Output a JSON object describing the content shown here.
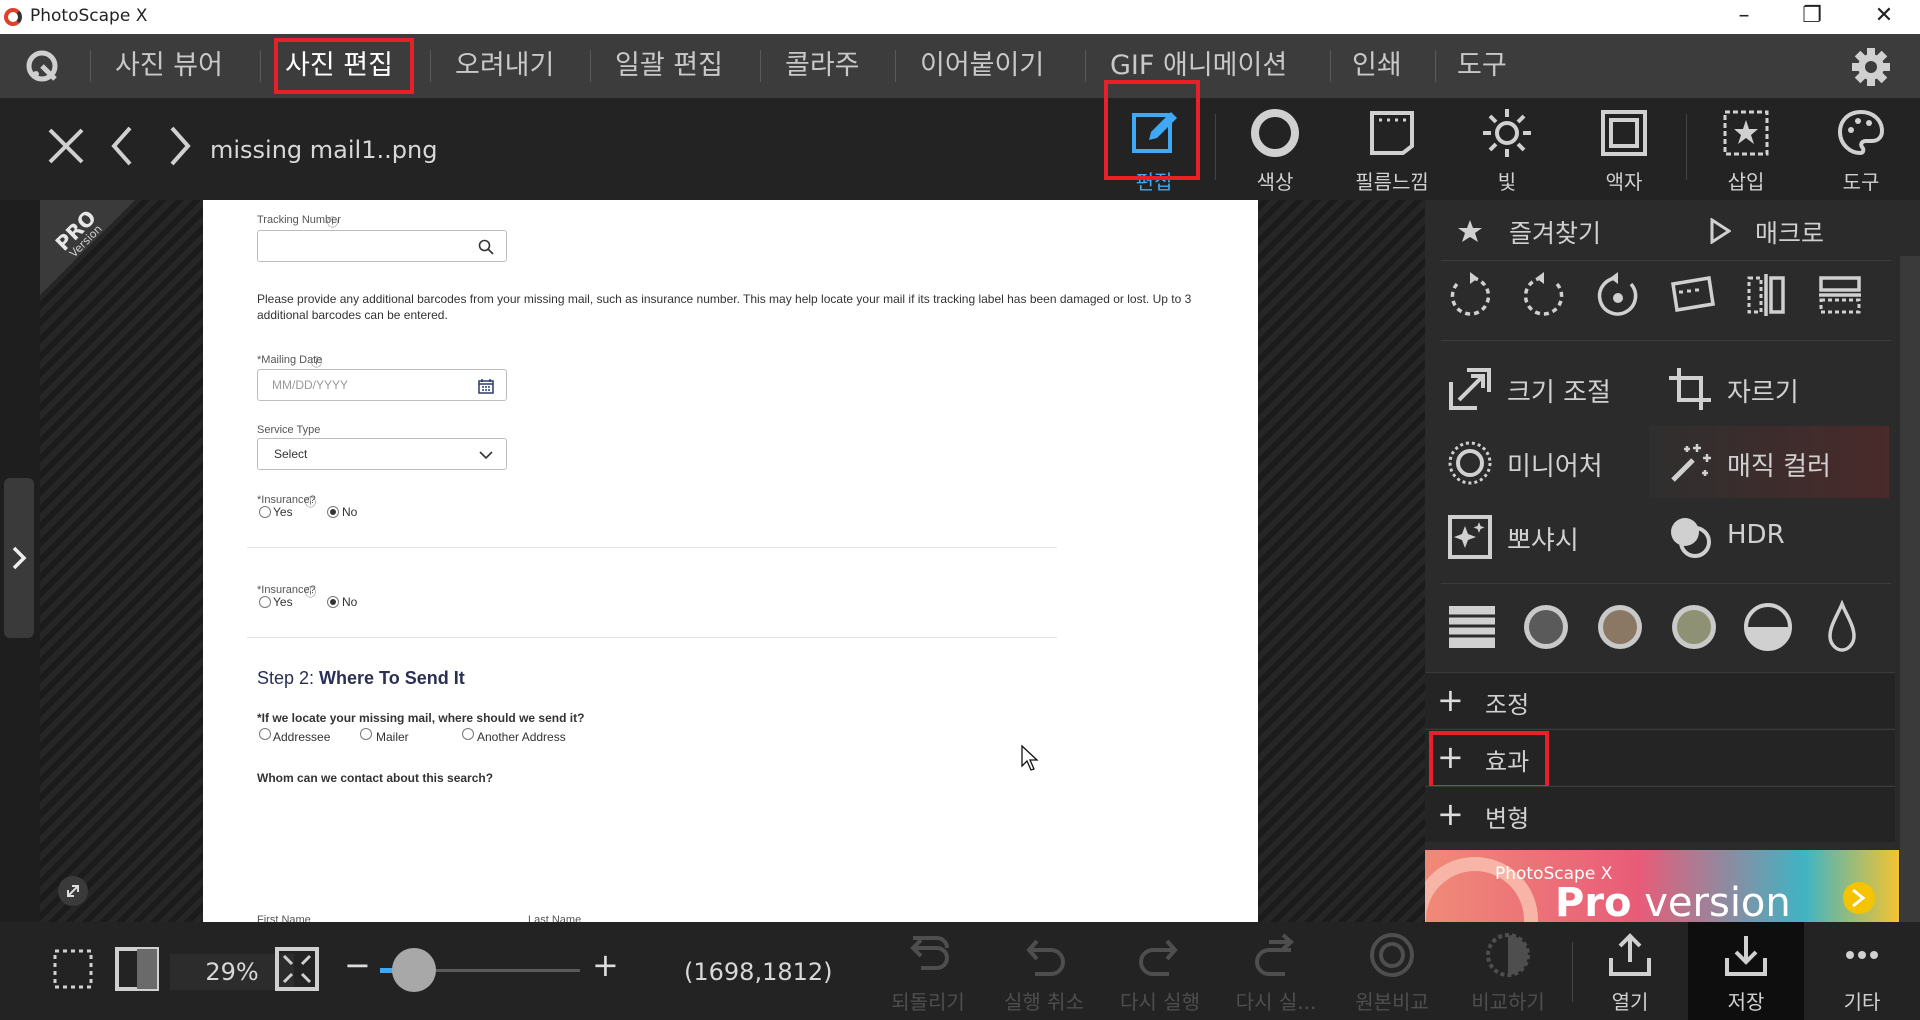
{
  "app": {
    "title": "PhotoScape X"
  },
  "menu": {
    "items": [
      "사진 뷰어",
      "사진 편집",
      "오려내기",
      "일괄 편집",
      "콜라주",
      "이어붙이기",
      "GIF 애니메이션",
      "인쇄",
      "도구"
    ],
    "active": "사진 편집"
  },
  "toolbar": {
    "filename": "missing mail1..png",
    "tools": [
      "편집",
      "색상",
      "필름느낌",
      "빛",
      "액자",
      "삽입",
      "도구"
    ]
  },
  "canvas": {
    "pro_badge": [
      "PRO",
      "Version"
    ],
    "doc": {
      "tracking_label": "Tracking Number",
      "barcode_text_1": "Please provide any additional barcodes from your missing mail, such as insurance number. This may help locate your mail if its tracking label has been damaged or lost. Up to 3",
      "barcode_text_2": "additional barcodes can be entered.",
      "mailing_label": "*Mailing Date",
      "date_placeholder": "MM/DD/YYYY",
      "service_label": "Service Type",
      "service_value": "Select",
      "insurance_label": "*Insurance?",
      "yes": "Yes",
      "no": "No",
      "step_prefix": "Step 2: ",
      "step_title": "Where To Send It",
      "question": "*If we locate your missing mail, where should we send it?",
      "opt_addressee": "Addressee",
      "opt_mailer": "Mailer",
      "opt_another": "Another Address",
      "contact": "Whom can we contact about this search?",
      "first_name": "First Name",
      "last_name": "Last Name"
    }
  },
  "panel": {
    "favorites": "즐겨찾기",
    "macro": "매크로",
    "features": [
      "크기 조절",
      "자르기",
      "미니어처",
      "매직 컬러",
      "뽀샤시",
      "HDR"
    ],
    "sections": [
      "조정",
      "효과",
      "변형"
    ],
    "banner": {
      "small": "PhotoScape X",
      "big_pro": "Pro",
      "big_version": " version"
    }
  },
  "bottom": {
    "zoom": "29%",
    "coords": "(1698,1812)",
    "actions": [
      "되돌리기",
      "실행 취소",
      "다시 실행",
      "다시 실...",
      "원본비교",
      "비교하기"
    ],
    "file_actions": [
      "열기",
      "저장",
      "기타"
    ]
  },
  "colors": {
    "accent": "#3fa9f5",
    "highlight": "#e8202a",
    "panel_bg": "#2b2b2b",
    "toolbar_bg": "#232323"
  },
  "states": {
    "zoom_slider_fraction": 0.17,
    "insurance_1": "No",
    "insurance_2": "No"
  }
}
